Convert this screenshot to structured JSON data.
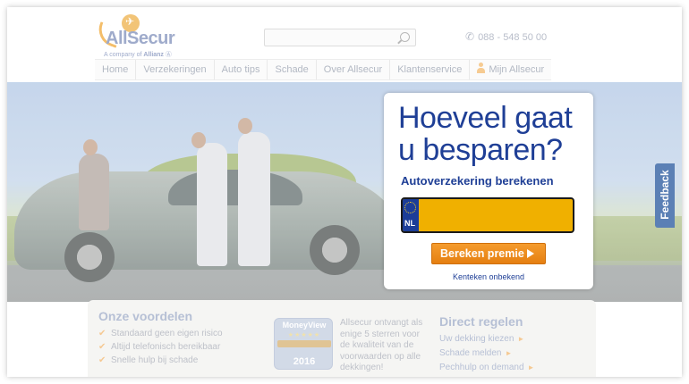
{
  "header": {
    "logo_text": "AllSecur",
    "logo_sub_prefix": "A company of",
    "logo_sub_brand": "Allianz",
    "search_placeholder": "",
    "phone": "088 - 548 50 00"
  },
  "nav": {
    "items": [
      "Home",
      "Verzekeringen",
      "Auto tips",
      "Schade",
      "Over Allsecur",
      "Klantenservice"
    ],
    "account_label": "Mijn Allsecur"
  },
  "calculator": {
    "title": "Hoeveel gaat u besparen?",
    "subtitle": "Autoverzekering berekenen",
    "plate_country": "NL",
    "plate_value": "",
    "button_label": "Bereken premie",
    "link_label": "Kenteken onbekend"
  },
  "feedback": {
    "label": "Feedback"
  },
  "advantages": {
    "title": "Onze voordelen",
    "items": [
      "Standaard geen eigen risico",
      "Altijd telefonisch bereikbaar",
      "Snelle hulp bij schade"
    ]
  },
  "badge": {
    "title": "MoneyView",
    "band_text": "",
    "year": "2016",
    "text": "Allsecur ontvangt als enige 5 sterren voor de kwaliteit van de voorwaarden op alle dekkingen!"
  },
  "direct": {
    "title": "Direct regelen",
    "items": [
      "Uw dekking kiezen",
      "Schade melden",
      "Pechhulp on demand"
    ]
  },
  "colors": {
    "brand_blue": "#1f3f96",
    "accent_orange": "#e57f11",
    "plate_yellow": "#f0b000",
    "feedback_blue": "#5b80b5"
  }
}
